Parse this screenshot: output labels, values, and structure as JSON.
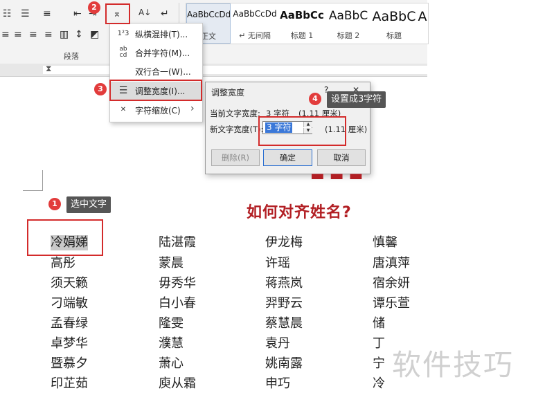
{
  "ribbon": {
    "paragraph_group_label": "段落",
    "styles": [
      {
        "preview": "AaBbCcDd",
        "name": "正文"
      },
      {
        "preview": "AaBbCcDd",
        "name": "↵ 无间隔"
      },
      {
        "preview": "AaBbCc",
        "name": "标题 1"
      },
      {
        "preview": "AaBbC",
        "name": "标题 2"
      },
      {
        "preview": "AaBbC",
        "name": "标题"
      },
      {
        "preview": "A",
        "name": ""
      }
    ]
  },
  "dropdown": {
    "items": [
      {
        "icon": "vertical-text-icon",
        "glyph": "1²3",
        "label": "纵横混排(T)..."
      },
      {
        "icon": "combine-chars-icon",
        "glyph": "ab cd",
        "label": "合并字符(M)..."
      },
      {
        "icon": "two-lines-in-one-icon",
        "glyph": "",
        "label": "双行合一(W)..."
      },
      {
        "icon": "fit-text-icon",
        "glyph": "☰",
        "label": "调整宽度(I)..."
      },
      {
        "icon": "character-scale-icon",
        "glyph": "✕",
        "label": "字符缩放(C)"
      }
    ],
    "submenu_arrow": "›"
  },
  "dialog": {
    "title": "调整宽度",
    "help": "?",
    "close": "✕",
    "current_label": "当前文字宽度:",
    "current_value": "3 字符",
    "current_cm": "(1.11 厘米)",
    "new_label": "新文字宽度(T):",
    "new_value": "3 字符",
    "new_cm": "(1.11 厘米)",
    "delete_label": "删除(R)",
    "ok_label": "确定",
    "cancel_label": "取消"
  },
  "steps": {
    "one": "1",
    "two": "2",
    "three": "3",
    "four": "4",
    "callout_select": "选中文字",
    "callout_set": "设置成3字符"
  },
  "document": {
    "title": "如何对齐姓名?",
    "columns": [
      [
        "冷娟娣",
        "高彤",
        "须天籁",
        "刁端敏",
        "孟春绿",
        "卓梦华",
        "暨慕夕",
        "印芷茹"
      ],
      [
        "陆湛霞",
        "蒙晨",
        "毋秀华",
        "白小春",
        "隆雯",
        "濮慧",
        "萧心",
        "庾从霜"
      ],
      [
        "伊龙梅",
        "许瑶",
        "蒋燕岚",
        "羿野云",
        "蔡慧晨",
        "袁丹",
        "姚南露",
        "申巧"
      ],
      [
        "慎馨",
        "唐滇萍",
        "宿余妍",
        "谭乐萱",
        "储",
        "丁",
        "宁",
        "冷"
      ]
    ]
  },
  "watermark": "软件技巧"
}
